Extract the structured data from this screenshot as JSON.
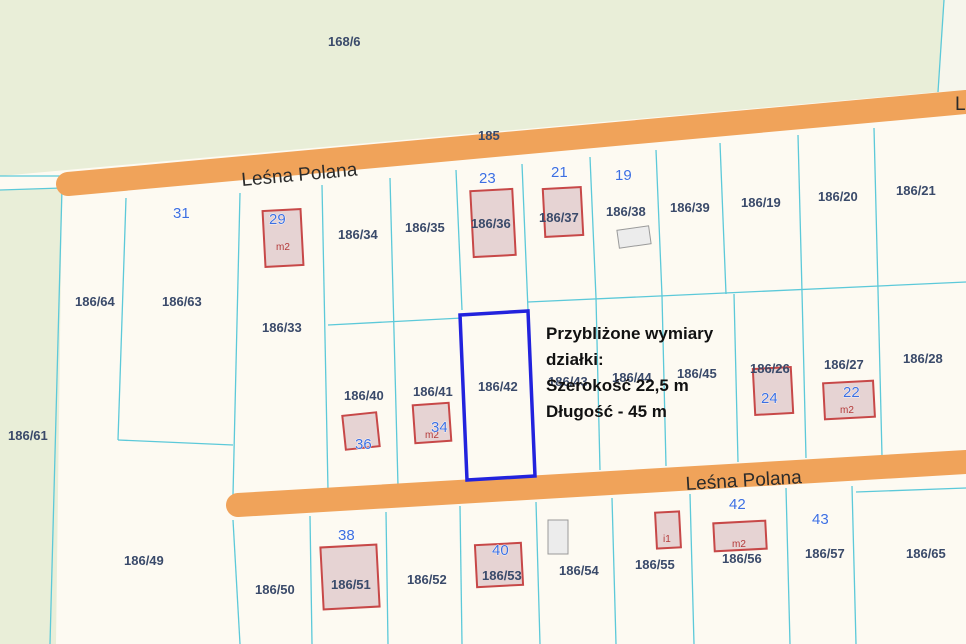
{
  "colors": {
    "background": "#fdfaf2",
    "green_area": "#e9eed8",
    "parcel_line": "#5cc9d9",
    "road": "#f0a35a",
    "building_outline": "#c74848",
    "building_fill": "#e6d3d3",
    "highlight": "#2222dd",
    "parcel_label": "#3a4a6a",
    "address_number": "#3d6fe0"
  },
  "roads": {
    "top": "Leśna Polana",
    "bottom": "Leśna Polana",
    "edge_letter": "L"
  },
  "parcels": {
    "p168_6": "168/6",
    "p185": "185",
    "p186_34": "186/34",
    "p186_35": "186/35",
    "p186_36": "186/36",
    "p186_37": "186/37",
    "p186_38": "186/38",
    "p186_39": "186/39",
    "p186_19": "186/19",
    "p186_20": "186/20",
    "p186_21": "186/21",
    "p186_64": "186/64",
    "p186_63": "186/63",
    "p186_33": "186/33",
    "p186_61": "186/61",
    "p186_40": "186/40",
    "p186_41": "186/41",
    "p186_42": "186/42",
    "p186_43": "186/43",
    "p186_44": "186/44",
    "p186_45": "186/45",
    "p186_26": "186/26",
    "p186_27": "186/27",
    "p186_28": "186/28",
    "p186_49": "186/49",
    "p186_50": "186/50",
    "p186_51": "186/51",
    "p186_52": "186/52",
    "p186_53": "186/53",
    "p186_54": "186/54",
    "p186_55": "186/55",
    "p186_56": "186/56",
    "p186_57": "186/57",
    "p186_65": "186/65"
  },
  "address_numbers": {
    "n31": "31",
    "n29": "29",
    "n23": "23",
    "n21": "21",
    "n19": "19",
    "n36": "36",
    "n34": "34",
    "n24": "24",
    "n22": "22",
    "n38": "38",
    "n40": "40",
    "n42": "42",
    "n43": "43"
  },
  "building_marks": {
    "m2_a": "m2",
    "m2_b": "m2",
    "m2_c": "m2",
    "m2_d": "m2",
    "i1": "i1"
  },
  "annotation": {
    "line1": "Przybliżone wymiary",
    "line2": "działki:",
    "line3": "Szerokość 22,5 m",
    "line4": "Długość - 45 m"
  }
}
